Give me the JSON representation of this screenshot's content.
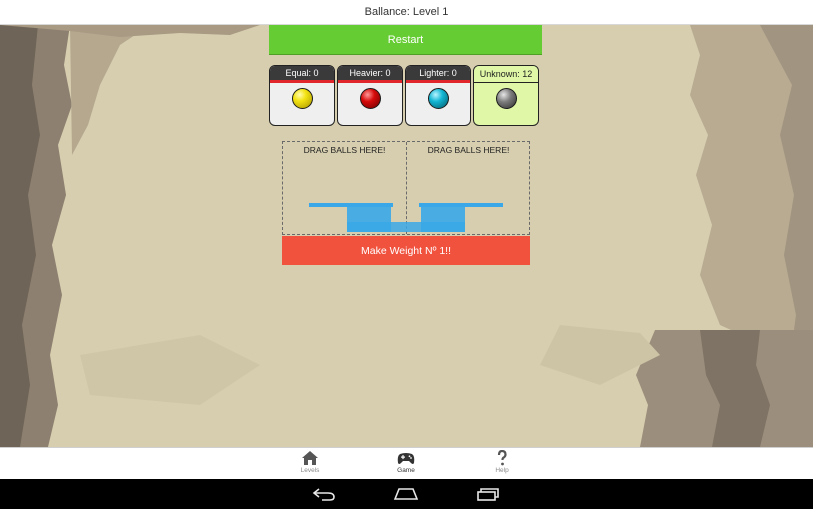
{
  "app": {
    "title": "Ballance: Level 1"
  },
  "controls": {
    "restart_label": "Restart",
    "weigh_label": "Make Weight Nº 1!!"
  },
  "categories": [
    {
      "label": "Equal: 0",
      "color": "#f3e313"
    },
    {
      "label": "Heavier: 0",
      "color": "#d60a0a"
    },
    {
      "label": "Lighter: 0",
      "color": "#12b6d4"
    },
    {
      "label": "Unknown: 12",
      "color": "#7d7d7d"
    }
  ],
  "scale": {
    "left_label": "DRAG BALLS HERE!",
    "right_label": "DRAG BALLS HERE!",
    "pan_color": "#3aa8e8"
  },
  "tabs": [
    {
      "label": "Levels",
      "icon": "home-icon"
    },
    {
      "label": "Game",
      "icon": "gamepad-icon",
      "active": true
    },
    {
      "label": "Help",
      "icon": "question-icon"
    }
  ],
  "colors": {
    "restart": "#66cc33",
    "weigh": "#f0523e",
    "unknown_card": "#dff7a6"
  }
}
